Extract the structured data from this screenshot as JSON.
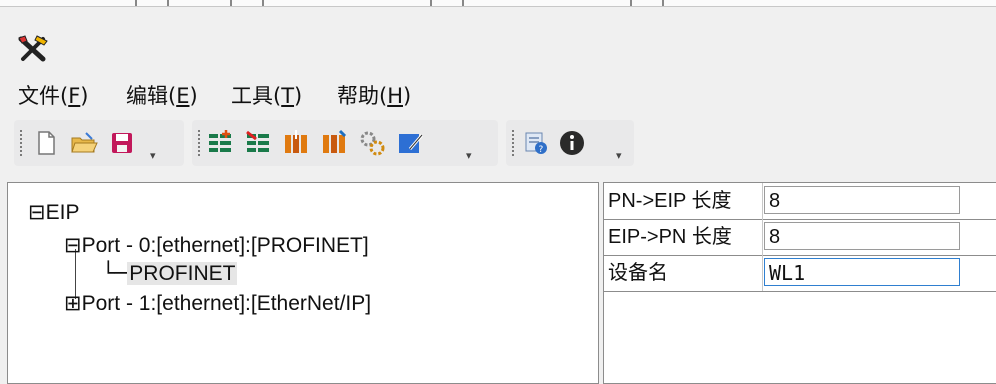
{
  "menu": {
    "file": {
      "label": "文件(",
      "acc": "F",
      "tail": ")"
    },
    "edit": {
      "label": "编辑(",
      "acc": "E",
      "tail": ")"
    },
    "tools": {
      "label": "工具(",
      "acc": "T",
      "tail": ")"
    },
    "help": {
      "label": "帮助(",
      "acc": "H",
      "tail": ")"
    }
  },
  "toolbar": {
    "group1": [
      "new-file-icon",
      "open-folder-icon",
      "save-icon"
    ],
    "group2": [
      "add-node-icon",
      "remove-node-icon",
      "import-module-icon",
      "export-module-icon",
      "settings-gear-icon",
      "edit-note-icon"
    ],
    "group3": [
      "refresh-help-icon",
      "info-icon"
    ]
  },
  "tree": {
    "root": {
      "expander": "⊟",
      "label": "EIP"
    },
    "port0": {
      "expander": "⊟",
      "label": "Port - 0:[ethernet]:[PROFINET]"
    },
    "port0_child": {
      "label": "PROFINET"
    },
    "port1": {
      "expander": "⊞",
      "label": "Port - 1:[ethernet]:[EtherNet/IP]"
    }
  },
  "properties": [
    {
      "label": "PN->EIP 长度",
      "value": "8"
    },
    {
      "label": "EIP->PN 长度",
      "value": "8"
    },
    {
      "label": "设备名",
      "value": "WL1"
    }
  ],
  "colors": {
    "accent": "#2f7fd0",
    "selected_bg": "#e6e6e6"
  }
}
